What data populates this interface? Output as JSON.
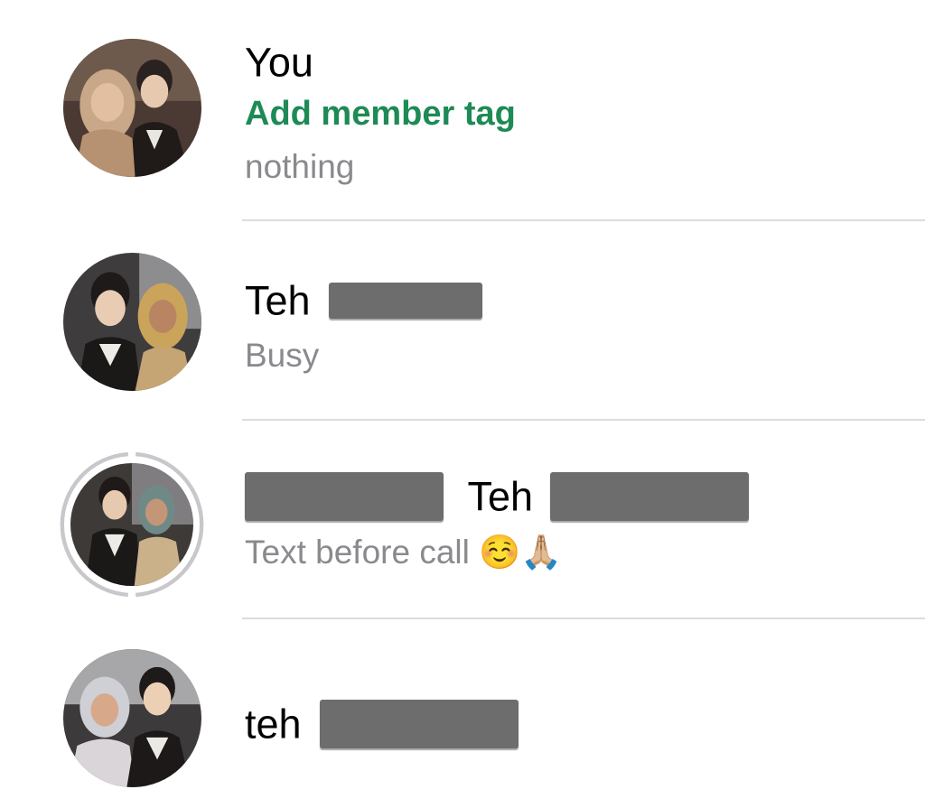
{
  "colors": {
    "tag_green": "#1e8a55",
    "secondary_text": "#8a8a8e",
    "redaction": "#6d6d6d",
    "divider": "#dcdcdc",
    "status_ring": "#c7c7cc"
  },
  "members": [
    {
      "name": "You",
      "tag_link": "Add member tag",
      "status": "nothing"
    },
    {
      "name_prefix": "Teh",
      "name_redacted": true,
      "status": "Busy"
    },
    {
      "name_redacted_prefix": true,
      "name_middle": "Teh",
      "name_redacted": true,
      "status": "Text before call ☺️🙏🏼",
      "has_status_ring": true
    },
    {
      "name_prefix": "teh",
      "name_redacted": true
    }
  ]
}
